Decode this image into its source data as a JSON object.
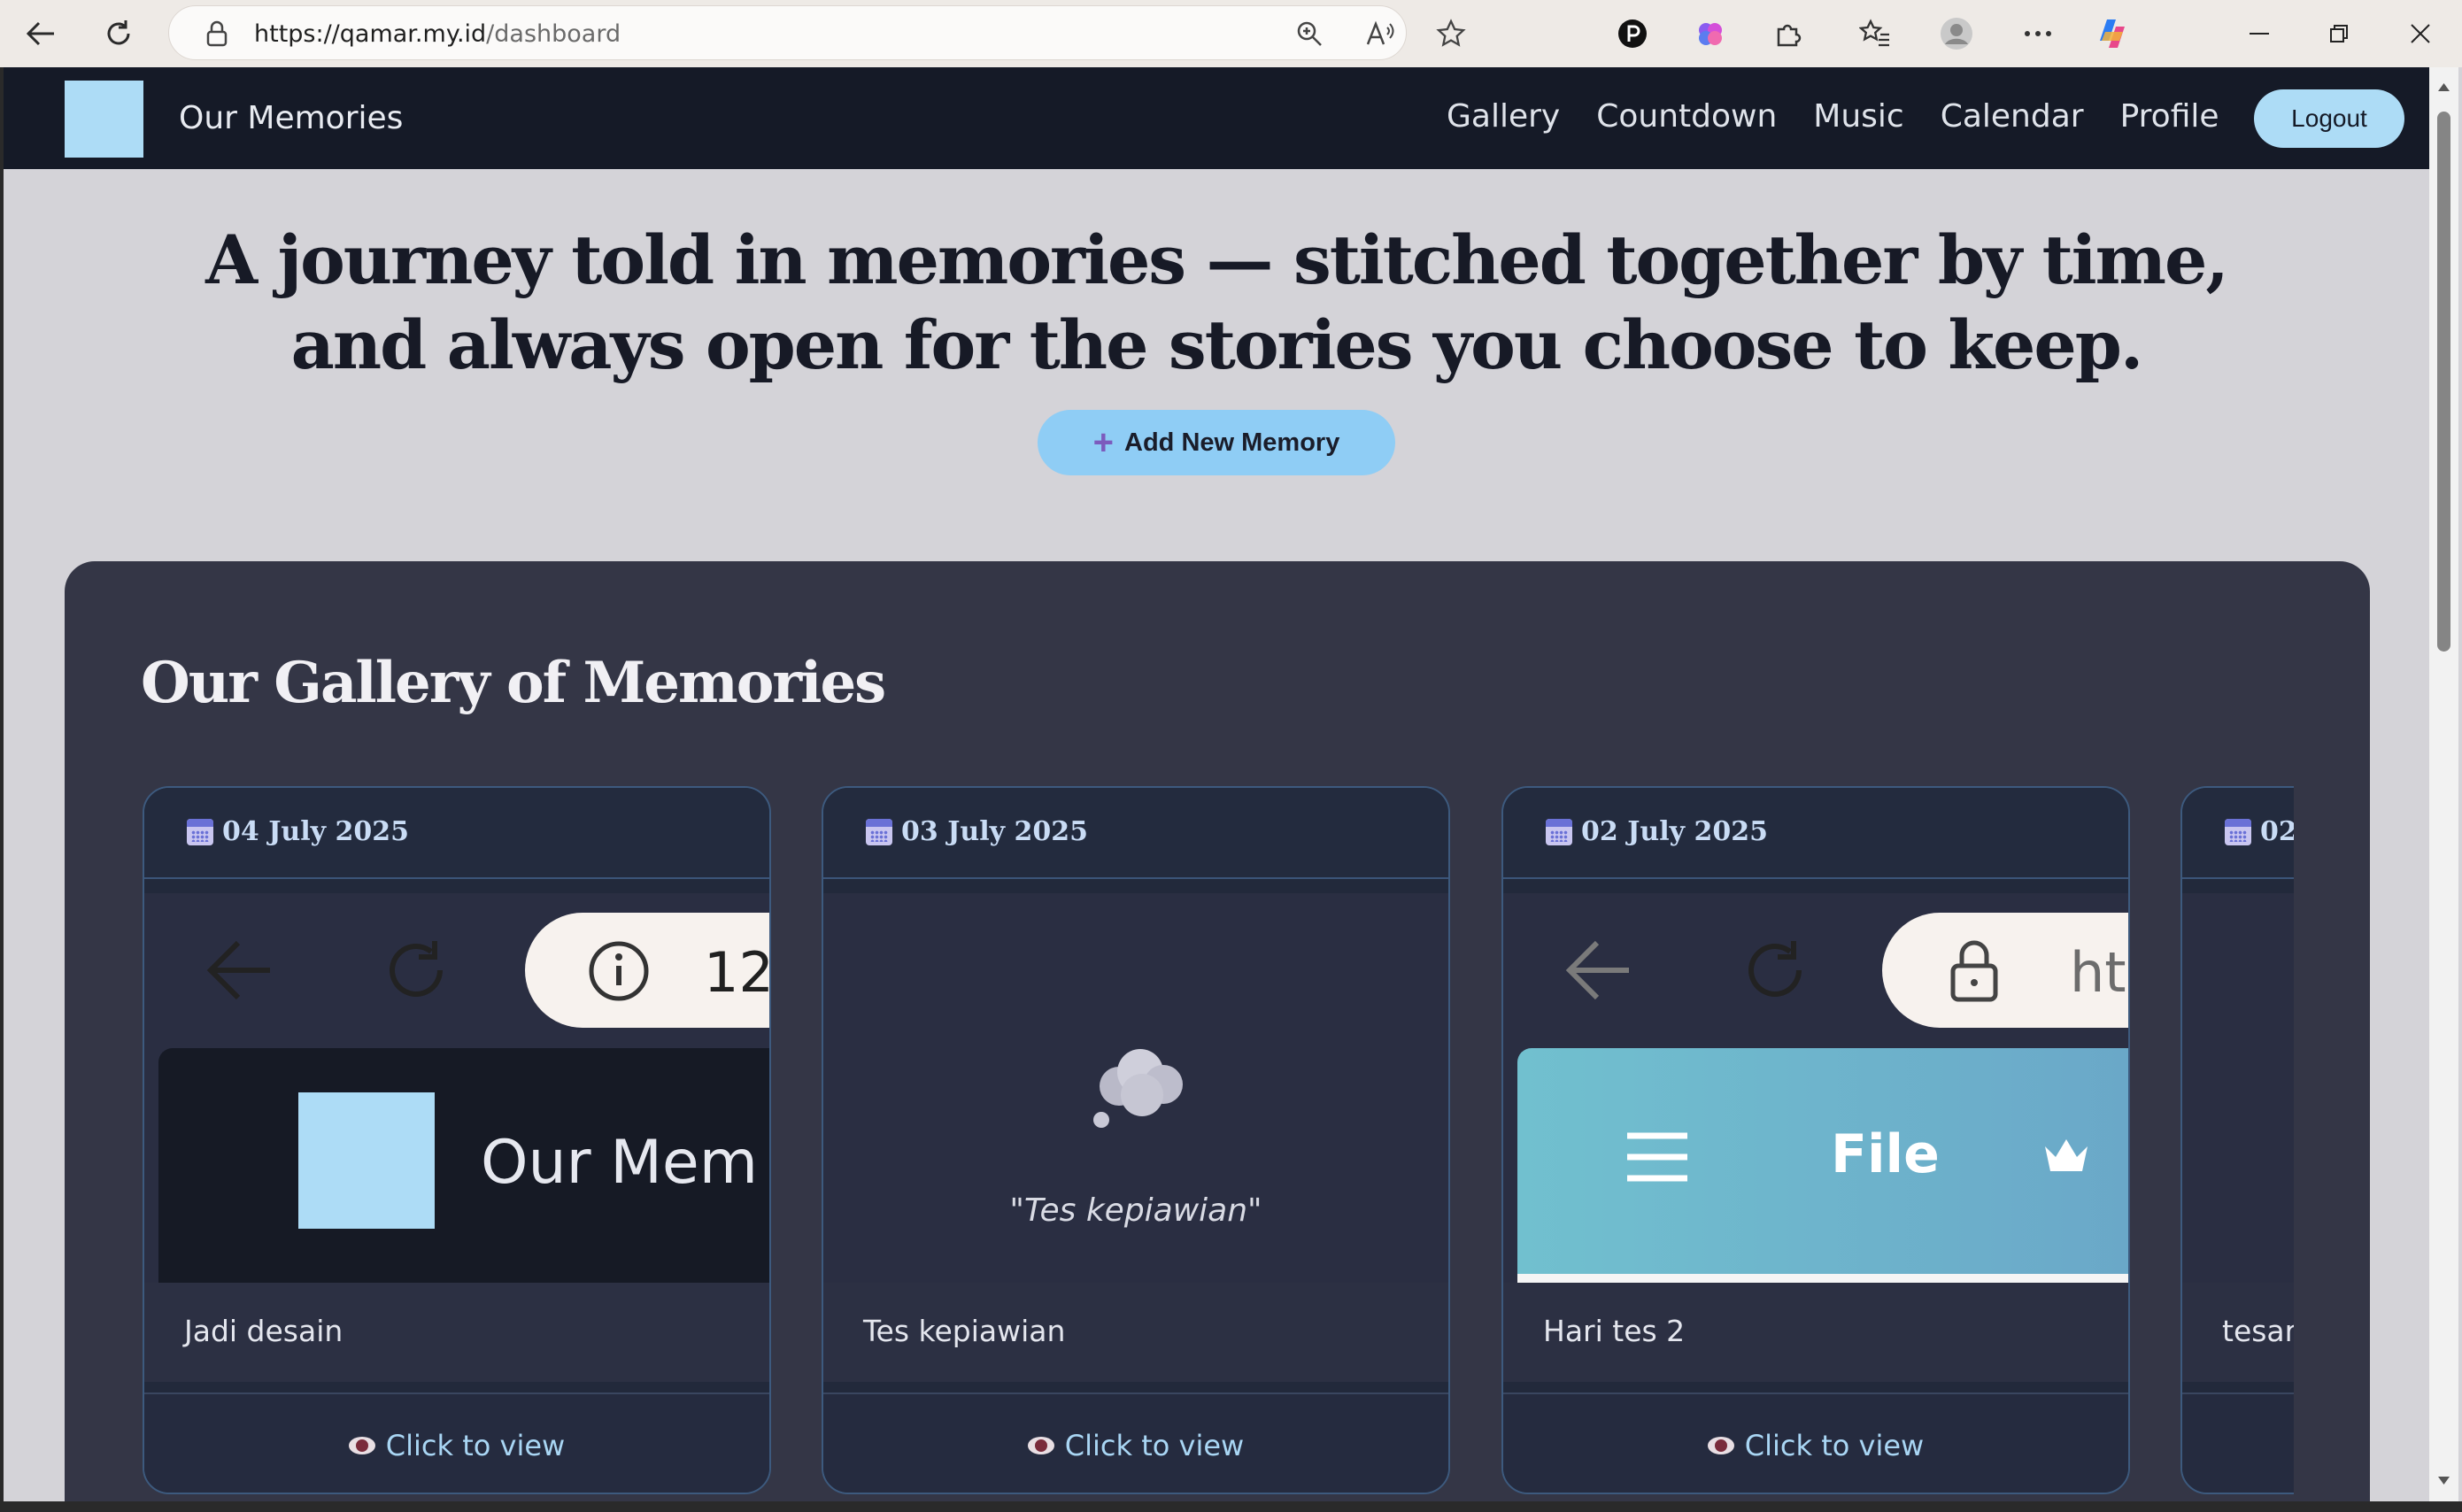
{
  "browser": {
    "url_host": "https://qamar.my.id",
    "url_path": "/dashboard"
  },
  "nav": {
    "brand": "Our Memories",
    "links": [
      "Gallery",
      "Countdown",
      "Music",
      "Calendar",
      "Profile"
    ],
    "logout_label": "Logout"
  },
  "hero": {
    "line1": "A journey told in memories — stitched together by time,",
    "line2": "and always open for the stories you choose to keep.",
    "add_button": "Add New Memory"
  },
  "gallery": {
    "title": "Our Gallery of Memories",
    "view_label": "Click to view",
    "cards": [
      {
        "date": "04 July 2025",
        "caption": "Jadi desain",
        "thumb_text": "Our Mem",
        "thumb_number": "12"
      },
      {
        "date": "03 July 2025",
        "caption": "Tes kepiawian",
        "quote": "\"Tes kepiawian\""
      },
      {
        "date": "02 July 2025",
        "caption": "Hari tes 2",
        "thumb_text": "File",
        "thumb_url": "ht"
      },
      {
        "date": "02",
        "caption": "tesar"
      }
    ]
  },
  "colors": {
    "accent": "#addcf6",
    "nav_bg": "#151a27",
    "panel_bg": "#343646"
  }
}
